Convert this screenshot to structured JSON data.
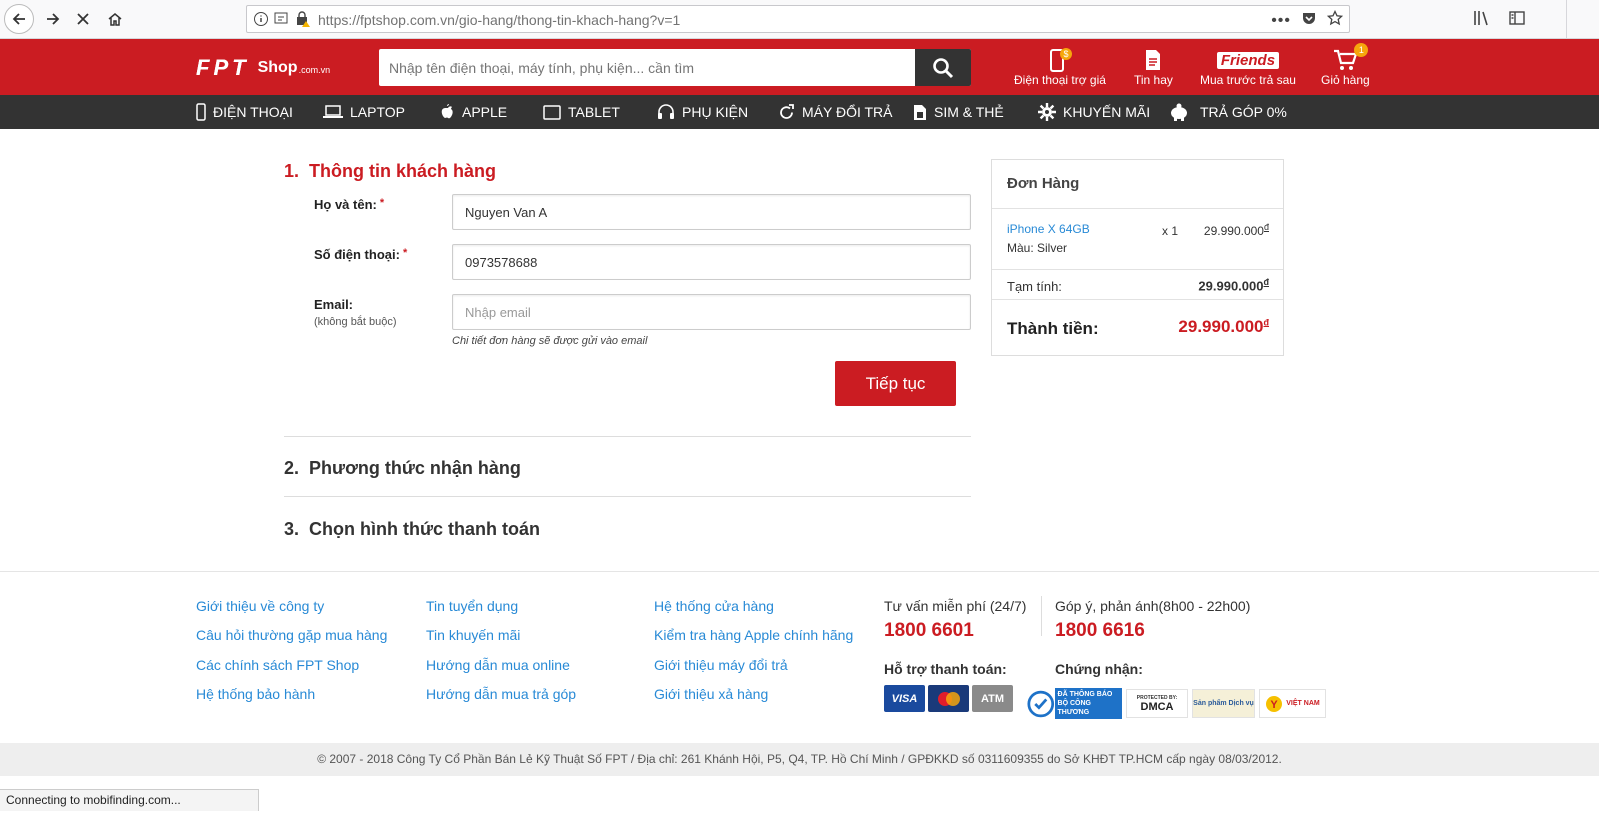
{
  "browser": {
    "url": "https://fptshop.com.vn/gio-hang/thong-tin-khach-hang?v=1",
    "status_text": "Connecting to mobifinding.com...",
    "icons": [
      "back-icon",
      "forward-icon",
      "stop-icon",
      "home-icon",
      "info-icon",
      "permissions-icon",
      "lock-warning-icon",
      "more-icon",
      "pocket-icon",
      "bookmark-star-icon",
      "library-icon",
      "sidebar-icon"
    ]
  },
  "header": {
    "logo_letters": "FPT",
    "logo_shop": "Shop",
    "logo_domain": ".com.vn",
    "search_placeholder": "Nhập tên điện thoại, máy tính, phụ kiện... cần tìm",
    "links": [
      {
        "label": "Điện thoại trợ giá",
        "icon": "phone-dollar-icon"
      },
      {
        "label": "Tin hay",
        "icon": "document-icon"
      },
      {
        "label": "Mua trước trả sau",
        "icon": "friends-logo-icon",
        "brand": "Friends"
      },
      {
        "label": "Giỏ hàng",
        "icon": "cart-icon",
        "badge": "1"
      }
    ]
  },
  "menu": [
    {
      "label": "ĐIỆN THOẠI",
      "icon": "mobile-icon"
    },
    {
      "label": "LAPTOP",
      "icon": "laptop-icon"
    },
    {
      "label": "APPLE",
      "icon": "apple-icon"
    },
    {
      "label": "TABLET",
      "icon": "tablet-icon"
    },
    {
      "label": "PHỤ KIỆN",
      "icon": "headphones-icon"
    },
    {
      "label": "MÁY ĐỔI TRẢ",
      "icon": "refresh-icon"
    },
    {
      "label": "SIM & THẺ",
      "icon": "sim-icon"
    },
    {
      "label": "KHUYẾN MÃI",
      "icon": "gear-icon"
    },
    {
      "label": "TRẢ GÓP 0%",
      "icon": "piggy-bank-icon"
    }
  ],
  "steps": [
    {
      "number": "1.",
      "title": "Thông tin khách hàng"
    },
    {
      "number": "2.",
      "title": "Phương thức nhận hàng"
    },
    {
      "number": "3.",
      "title": "Chọn hình thức thanh toán"
    }
  ],
  "form": {
    "name_label": "Họ và tên:",
    "name_value": "Nguyen Van A",
    "phone_label": "Số điện thoại:",
    "phone_value": "0973578688",
    "email_label": "Email:",
    "email_sub": "(không bắt buộc)",
    "email_placeholder": "Nhập email",
    "required_mark": "*",
    "email_hint": "Chi tiết đơn hàng sẽ được gửi vào email",
    "continue_label": "Tiếp tục"
  },
  "order": {
    "title": "Đơn Hàng",
    "item_name": "iPhone X 64GB",
    "item_color": "Màu: Silver",
    "item_qty": "x 1",
    "item_price": "29.990.000",
    "currency": "đ",
    "subtotal_label": "Tạm tính:",
    "subtotal_value": "29.990.000",
    "total_label": "Thành tiền:",
    "total_value": "29.990.000"
  },
  "footer": {
    "col1": [
      "Giới thiệu về công ty",
      "Câu hỏi thường gặp mua hàng",
      "Các chính sách FPT Shop",
      "Hệ thống bảo hành"
    ],
    "col2": [
      "Tin tuyển dụng",
      "Tin khuyến mãi",
      "Hướng dẫn mua online",
      "Hướng dẫn mua trả góp"
    ],
    "col3": [
      "Hệ thống cửa hàng",
      "Kiểm tra hàng Apple chính hãng",
      "Giới thiệu máy đổi trả",
      "Giới thiệu xả hàng"
    ],
    "consult_label": "Tư vấn miễn phí (24/7)",
    "consult_phone": "1800 6601",
    "feedback_label": "Góp ý, phản ánh(8h00 - 22h00)",
    "feedback_phone": "1800 6616",
    "payment_label": "Hỗ trợ thanh toán:",
    "payment_methods": [
      "VISA",
      "MasterCard",
      "ATM"
    ],
    "cert_label": "Chứng nhận:",
    "certs": [
      {
        "text": "ĐÃ THÔNG BÁO",
        "sub": "BỘ CÔNG THƯƠNG"
      },
      {
        "text": "DMCA",
        "sub": "PROTECTED BY:"
      },
      {
        "text": "Sản phẩm Dịch vụ"
      },
      {
        "text": "VIỆT NAM"
      }
    ],
    "copyright": "© 2007 - 2018 Công Ty Cổ Phần Bán Lẻ Kỹ Thuật Số FPT / Địa chỉ: 261 Khánh Hội, P5, Q4, TP. Hồ Chí Minh / GPĐKKD số 0311609355 do Sở KHĐT TP.HCM cấp ngày 08/03/2012."
  },
  "colors": {
    "brand_red": "#cb1c22",
    "link_blue": "#288ad6",
    "menu_dark": "#333333"
  }
}
